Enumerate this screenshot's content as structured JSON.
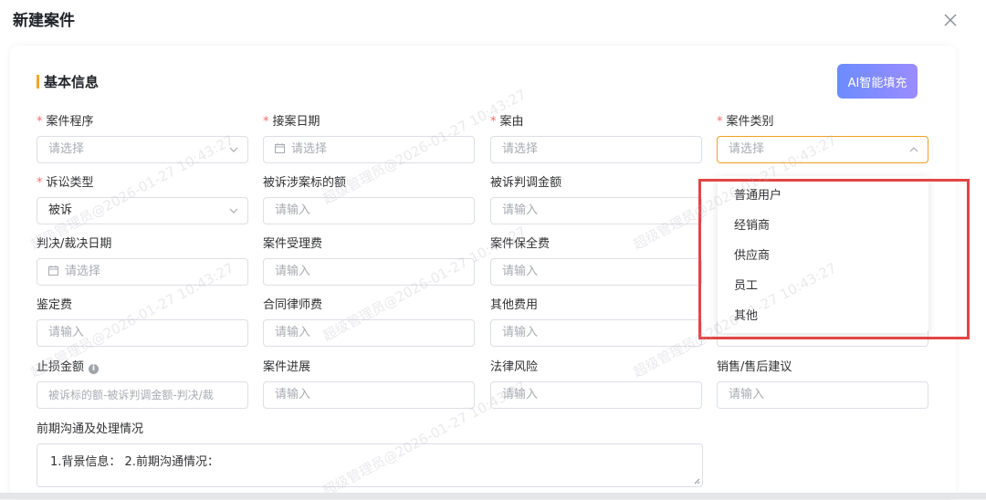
{
  "dialog": {
    "title": "新建案件",
    "close_icon": "close-icon"
  },
  "section": {
    "title": "基本信息",
    "accent_color": "#f5a623"
  },
  "ai_button": {
    "label": "AI智能填充"
  },
  "fields": {
    "case_procedure": {
      "label": "案件程序",
      "required": true,
      "placeholder": "请选择"
    },
    "accept_date": {
      "label": "接案日期",
      "required": true,
      "placeholder": "请选择"
    },
    "case_cause": {
      "label": "案由",
      "required": true,
      "placeholder": "请选择"
    },
    "case_category": {
      "label": "案件类别",
      "required": true,
      "placeholder": "请选择"
    },
    "litigation_type": {
      "label": "诉讼类型",
      "required": true,
      "value": "被诉"
    },
    "sued_amount": {
      "label": "被诉涉案标的额",
      "placeholder": "请输入"
    },
    "sued_mediation": {
      "label": "被诉判调金额",
      "placeholder": "请输入"
    },
    "judgment_date": {
      "label": "判决/裁决日期",
      "placeholder": "请选择"
    },
    "acceptance_fee": {
      "label": "案件受理费",
      "placeholder": "请输入"
    },
    "preservation_fee": {
      "label": "案件保全费",
      "placeholder": "请输入"
    },
    "appraisal_fee": {
      "label": "鉴定费",
      "placeholder": "请输入"
    },
    "lawyer_fee": {
      "label": "合同律师费",
      "placeholder": "请输入"
    },
    "other_fee": {
      "label": "其他费用",
      "placeholder": "请输入"
    },
    "loss_stop": {
      "label": "止损金额",
      "placeholder": "被诉标的额-被诉判调金额-判决/裁"
    },
    "case_progress": {
      "label": "案件进展",
      "placeholder": "请输入"
    },
    "legal_risk": {
      "label": "法律风险",
      "placeholder": "请输入"
    },
    "sales_advice": {
      "label": "销售/售后建议",
      "placeholder": "请输入"
    },
    "prior_comm": {
      "label": "前期沟通及处理情况",
      "value": "1.背景信息：  2.前期沟通情况："
    }
  },
  "category_dropdown": {
    "options": [
      "普通用户",
      "经销商",
      "供应商",
      "员工",
      "其他"
    ],
    "highlight_color": "#e24545"
  },
  "watermark": {
    "text": "超级管理员@2026-01-27 10:43:27"
  }
}
